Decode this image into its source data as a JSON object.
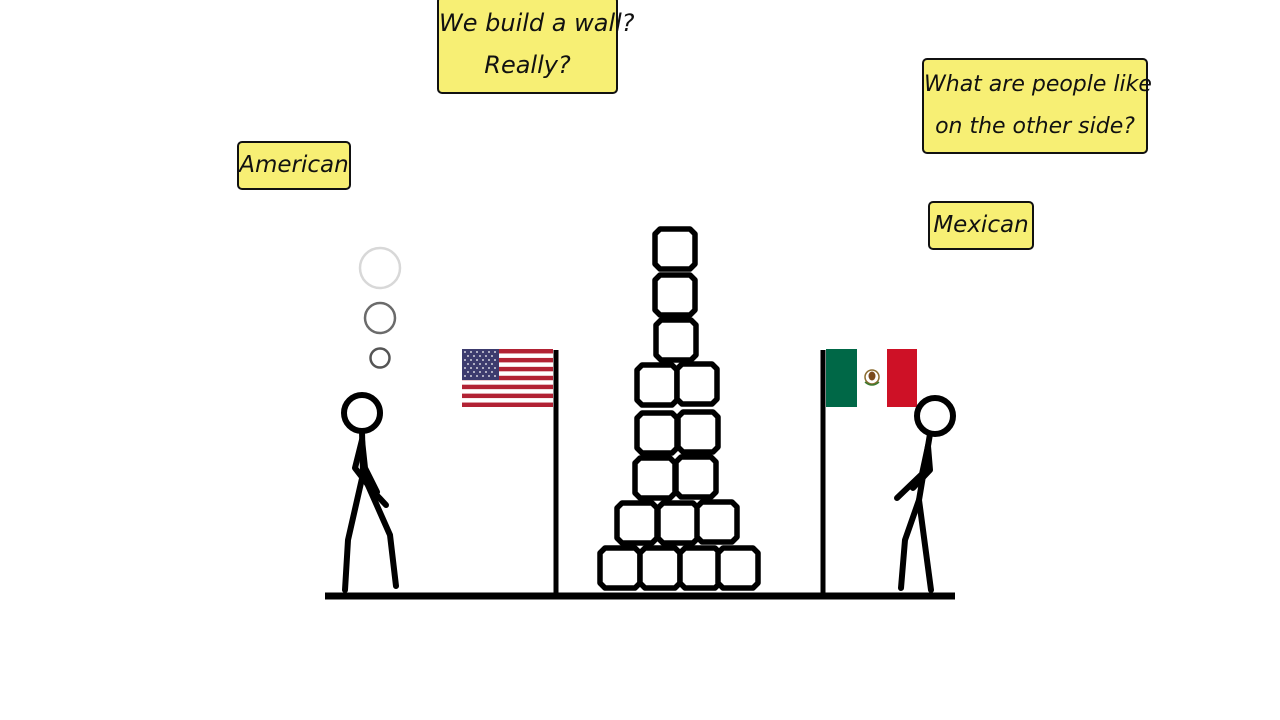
{
  "labels": {
    "american": "American",
    "mexican": "Mexican"
  },
  "speech": {
    "american_line1": "We build a wall?",
    "american_line2": "Really?",
    "mexican_line1": "What are people like",
    "mexican_line2": "on the other side?"
  },
  "colors": {
    "note_fill": "#f7ef74",
    "ink": "#111111",
    "us_red": "#b22234",
    "us_blue": "#3c3b6e",
    "mx_green": "#006847",
    "mx_red": "#ce1126"
  },
  "icons": {
    "us_flag": "us-flag-icon",
    "mx_flag": "mexico-flag-icon"
  }
}
